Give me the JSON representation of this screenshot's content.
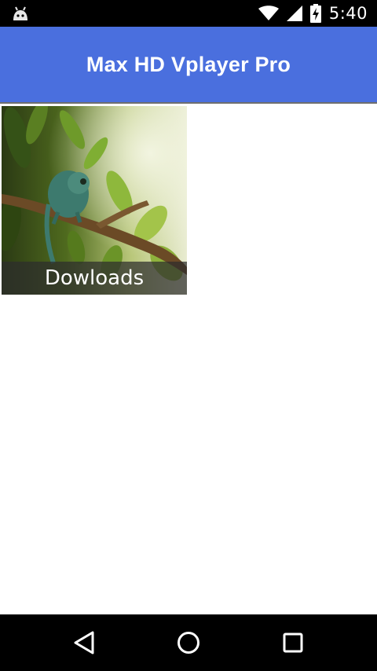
{
  "status_bar": {
    "time": "5:40",
    "icons": [
      "android-debug-icon",
      "wifi-icon",
      "signal-icon",
      "battery-charging-icon"
    ]
  },
  "app_bar": {
    "title": "Max HD Vplayer Pro",
    "color": "#4a6fde"
  },
  "folders": [
    {
      "label": "Dowloads",
      "thumbnail": "chameleon-on-branch"
    }
  ],
  "nav_bar": {
    "buttons": [
      "back-icon",
      "home-icon",
      "recents-icon"
    ]
  }
}
